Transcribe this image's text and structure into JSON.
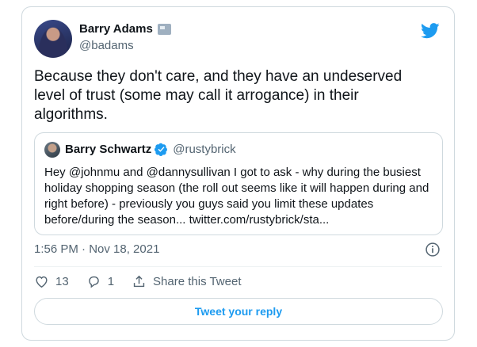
{
  "tweet": {
    "author_name": "Barry Adams",
    "author_handle": "@badams",
    "text": "Because they don't care, and they have an undeserved level of trust (some may call it arrogance) in their algorithms.",
    "timestamp": "1:56 PM · Nov 18, 2021"
  },
  "quoted": {
    "author_name": "Barry Schwartz",
    "author_handle": "@rustybrick",
    "text": "Hey @johnmu and @dannysullivan I got to ask - why during the busiest holiday shopping season (the roll out seems like it will happen during and right before) - previously you guys said you limit these updates before/during the season... twitter.com/rustybrick/sta..."
  },
  "actions": {
    "likes": "13",
    "replies": "1",
    "share_label": "Share this Tweet"
  },
  "reply_button_label": "Tweet your reply",
  "colors": {
    "accent": "#1d9bf0",
    "secondary_text": "#536471",
    "border": "#cfd9de"
  },
  "icons": [
    "twitter-bird-icon",
    "verified-badge-icon",
    "info-icon",
    "heart-icon",
    "reply-icon",
    "share-icon"
  ]
}
